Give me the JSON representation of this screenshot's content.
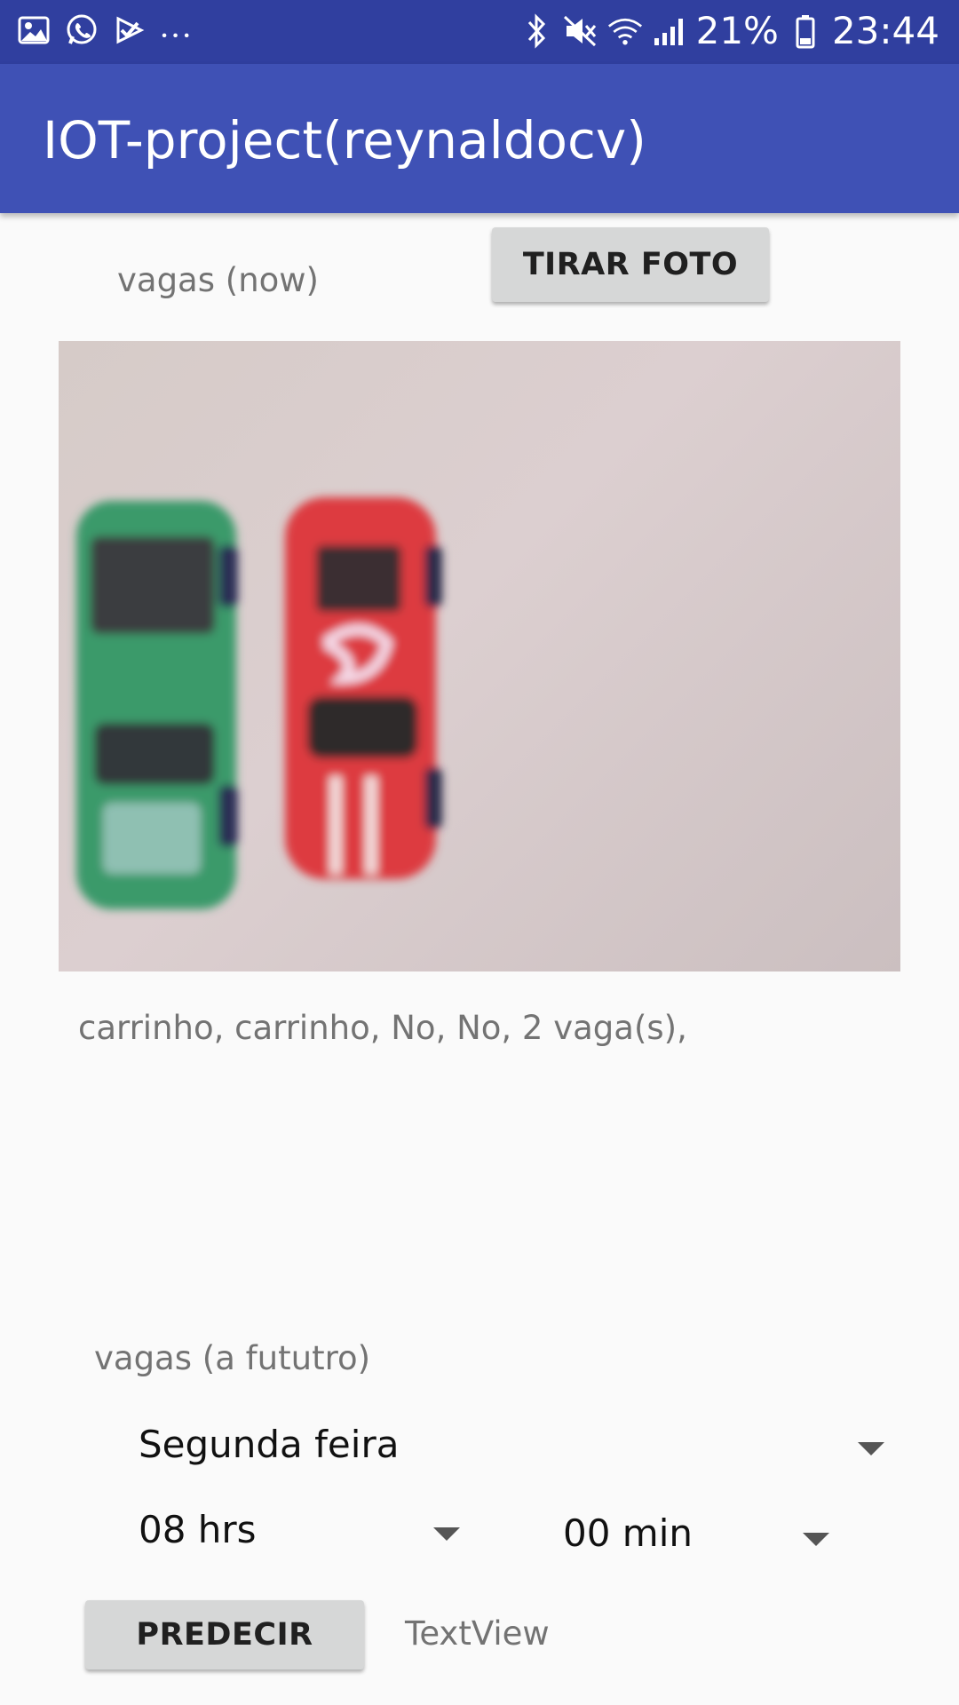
{
  "status_bar": {
    "icons_left": [
      "image-icon",
      "whatsapp-icon",
      "task-check-icon"
    ],
    "overflow": "...",
    "icons_right": [
      "bluetooth-icon",
      "mute-icon",
      "wifi-icon",
      "signal-icon",
      "battery-icon"
    ],
    "battery": "21%",
    "time": "23:44"
  },
  "app_bar": {
    "title": "IOT-project(reynaldocv)"
  },
  "now": {
    "label": "vagas (now)",
    "photo_button": "TIRAR FOTO",
    "result": "carrinho, carrinho, No, No, 2 vaga(s),"
  },
  "future": {
    "label": "vagas (a fututro)",
    "day": "Segunda feira",
    "hour": "08 hrs",
    "minute": "00 min",
    "predict_button": "PREDECIR",
    "output": "TextView"
  }
}
